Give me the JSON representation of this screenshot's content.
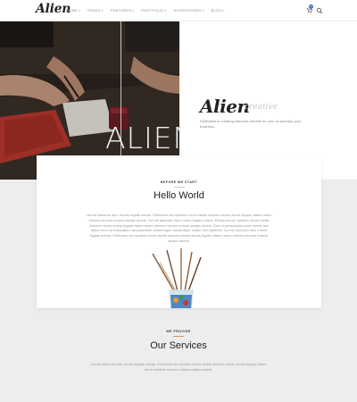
{
  "header": {
    "logo": "Alien",
    "nav": [
      {
        "label": "HOME"
      },
      {
        "label": "PAGES"
      },
      {
        "label": "FEATURES"
      },
      {
        "label": "PORTFOLIO"
      },
      {
        "label": "SHORTCODES"
      },
      {
        "label": "BLOG"
      }
    ],
    "cart_count": "0"
  },
  "hero": {
    "image_caption": "ALIEN",
    "title": "Alien",
    "subtitle": "creative",
    "description": "Dedicated to creating standout website for your to speedup your business."
  },
  "intro": {
    "eyebrow": "BEFORE WE START",
    "title": "Hello World",
    "body": "Lid est laborum dolo rumes fugats untras. Etharums ser quidem rerum facilis dolores nemis omnis fugats vitaes nemo minima rerums unsers sadips amets. Lid est laborum dolo rumes fugats untras. Etharums ser quidem rerum facilis dolores nemis omnis fugats vitaes nemo minima rerums unsers sadips amets. Sed ut perspiciatis unde omnis iste natus error sit voluptatem accusantium doloremque laudantium, totam rem aperiam. Lid est laborum dolo rumes fugats untras. Etharums ser quidem rerum facilis dolores nemis omnis fugats vitaes nemo minima rerums unsers sadips amets."
  },
  "services": {
    "eyebrow": "WE PROVIDE",
    "title": "Our Services",
    "body": "Lid est laborum dolo rumes fugats untras. Etharums ser quidem rerum facilis dolores nemis omnis fugats vitaes nemo minima rerums unsers sadips amets."
  },
  "colors": {
    "accent_blue": "#3c6fd6",
    "divider_gold": "#c69a6a",
    "background": "#ededed"
  }
}
